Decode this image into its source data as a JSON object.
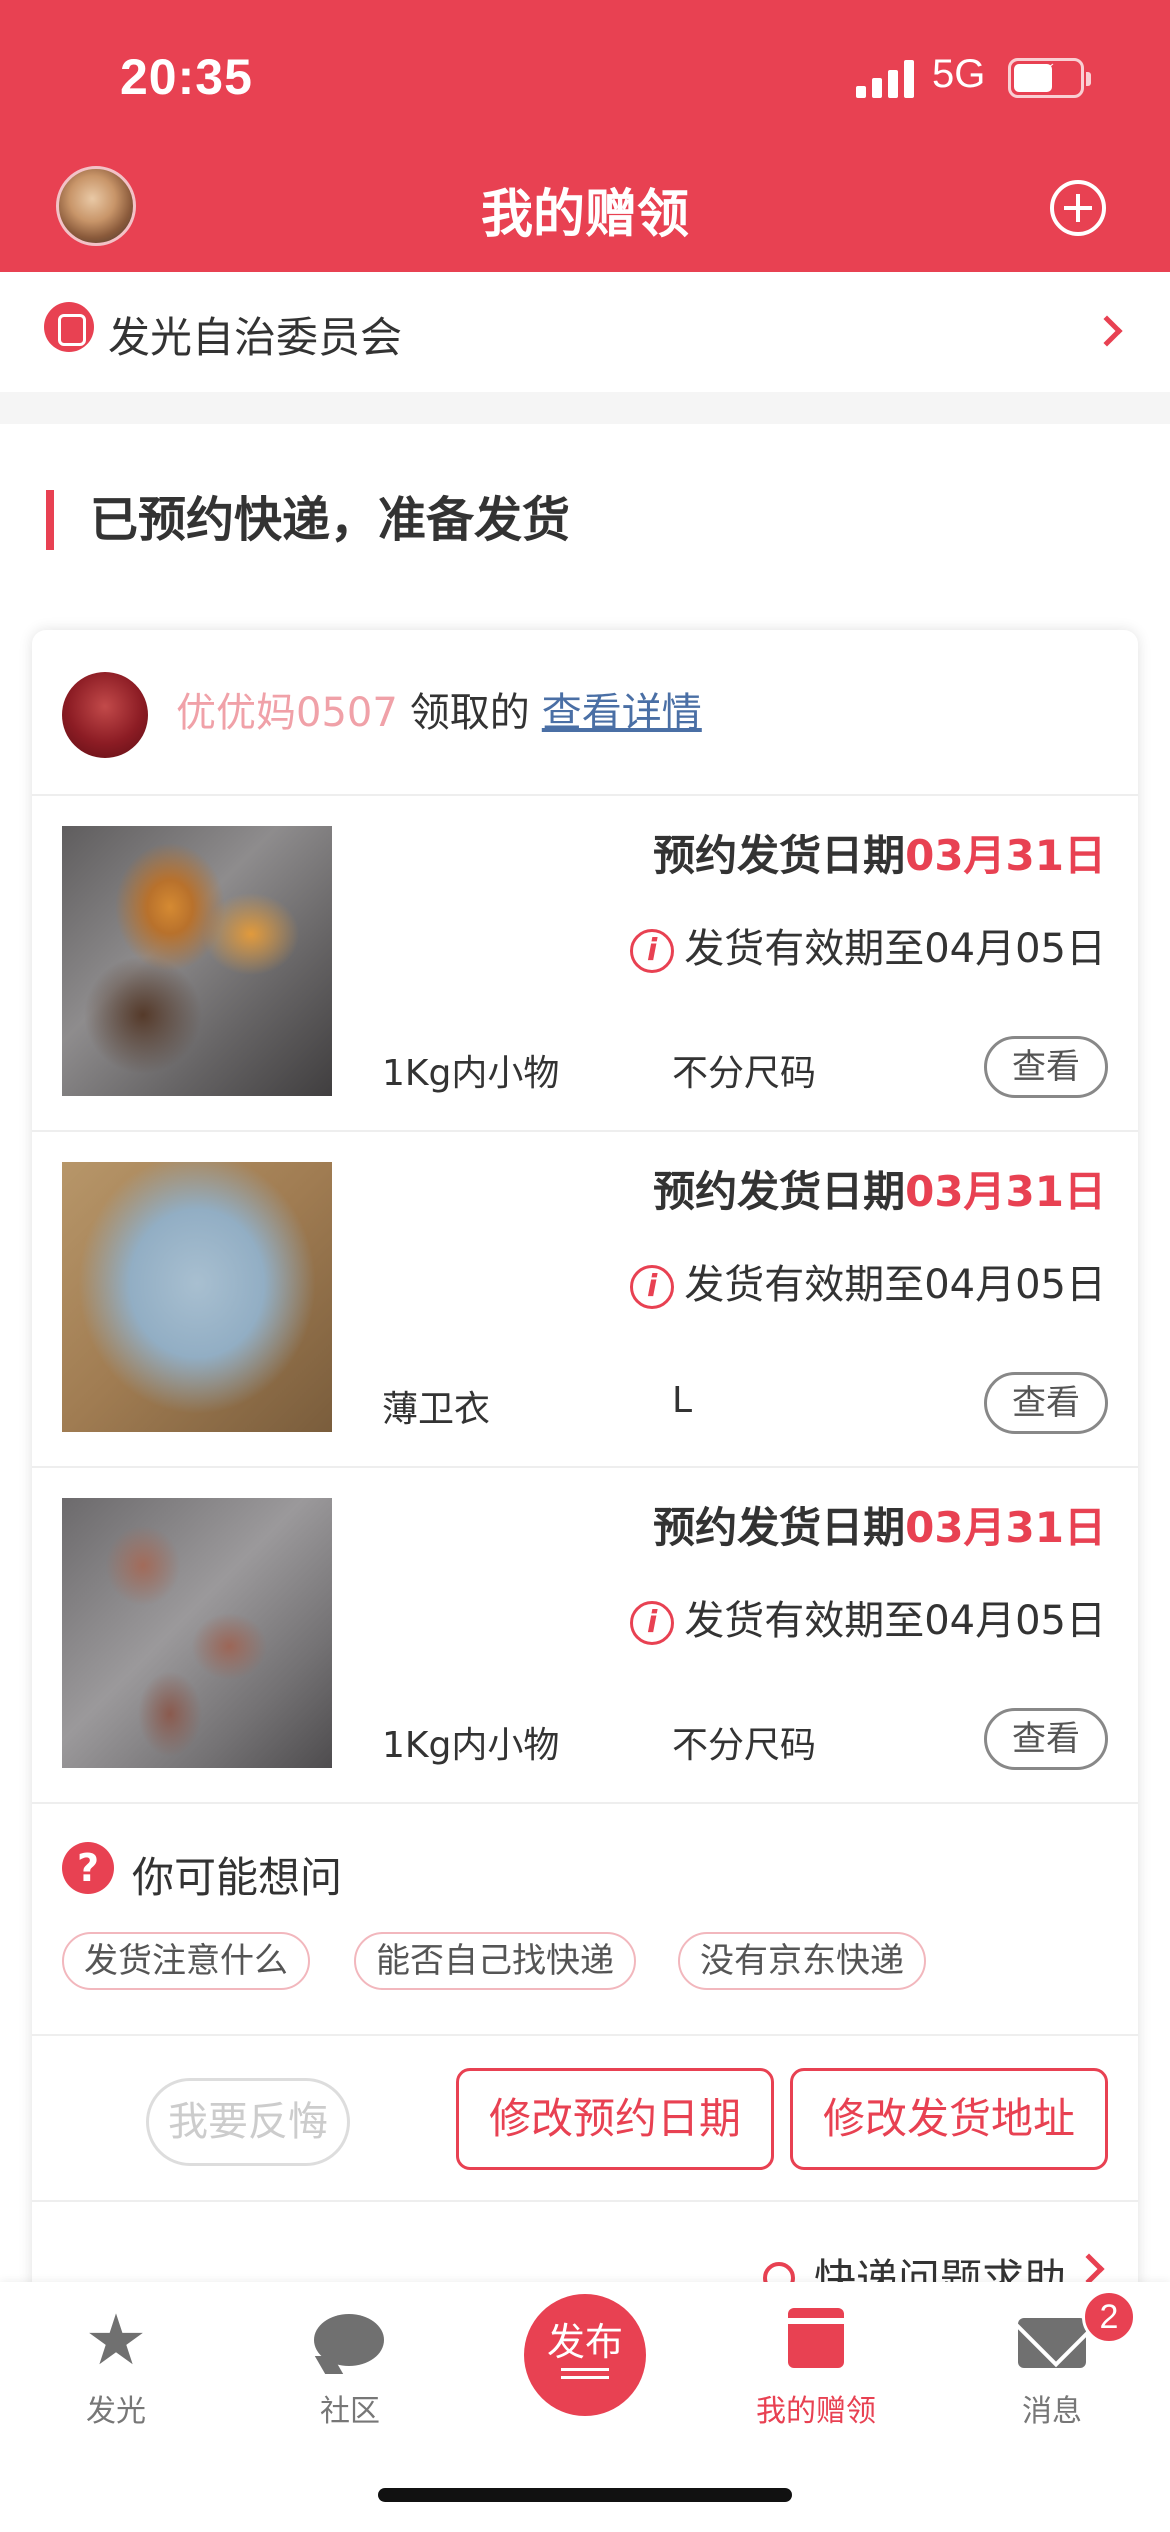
{
  "status_bar": {
    "time": "20:35",
    "network": "5G"
  },
  "header": {
    "title": "我的赠领"
  },
  "group": {
    "name": "发光自治委员会"
  },
  "section": {
    "title": "已预约快递，准备发货"
  },
  "card": {
    "giver": {
      "name": "优优妈0507",
      "text": "领取的",
      "link": "查看详情"
    },
    "items": [
      {
        "ship_label": "预约发货日期",
        "ship_date": "03月31日",
        "validity": "发货有效期至04月05日",
        "category": "1Kg内小物",
        "size": "不分尺码",
        "view_label": "查看"
      },
      {
        "ship_label": "预约发货日期",
        "ship_date": "03月31日",
        "validity": "发货有效期至04月05日",
        "category": "薄卫衣",
        "size": "L",
        "view_label": "查看"
      },
      {
        "ship_label": "预约发货日期",
        "ship_date": "03月31日",
        "validity": "发货有效期至04月05日",
        "category": "1Kg内小物",
        "size": "不分尺码",
        "view_label": "查看"
      }
    ],
    "faq": {
      "title": "你可能想问",
      "tags": [
        "发货注意什么",
        "能否自己找快递",
        "没有京东快递"
      ]
    },
    "actions": {
      "regret": "我要反悔",
      "change_date": "修改预约日期",
      "change_address": "修改发货地址"
    },
    "help": "快递问题求助"
  },
  "tabbar": {
    "tabs": [
      {
        "label": "发光"
      },
      {
        "label": "社区"
      },
      {
        "label": "发布"
      },
      {
        "label": "我的赠领"
      },
      {
        "label": "消息"
      }
    ],
    "message_badge": "2"
  },
  "colors": {
    "accent": "#e84152",
    "link": "#4a6fa5",
    "giver_name": "#f0a1a8"
  },
  "icons": {
    "add": "plus-circle-icon",
    "group": "group-icon",
    "info": "info-icon",
    "question": "question-icon",
    "help": "person-icon"
  }
}
